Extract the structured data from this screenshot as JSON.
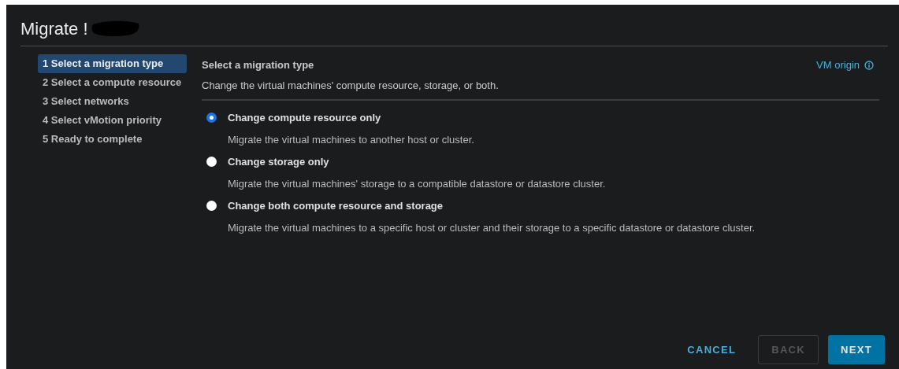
{
  "dialog": {
    "title": "Migrate !"
  },
  "steps": [
    {
      "label": "1 Select a migration type",
      "selected": true
    },
    {
      "label": "2 Select a compute resource",
      "selected": false
    },
    {
      "label": "3 Select networks",
      "selected": false
    },
    {
      "label": "4 Select vMotion priority",
      "selected": false
    },
    {
      "label": "5 Ready to complete",
      "selected": false
    }
  ],
  "content": {
    "heading": "Select a migration type",
    "subtitle": "Change the virtual machines' compute resource, storage, or both.",
    "link": "VM origin"
  },
  "options": [
    {
      "label": "Change compute resource only",
      "description": "Migrate the virtual machines to another host or cluster.",
      "selected": true
    },
    {
      "label": "Change storage only",
      "description": "Migrate the virtual machines' storage to a compatible datastore or datastore cluster.",
      "selected": false
    },
    {
      "label": "Change both compute resource and storage",
      "description": "Migrate the virtual machines to a specific host or cluster and their storage to a specific datastore or datastore cluster.",
      "selected": false
    }
  ],
  "buttons": [
    {
      "label": "CANCEL",
      "kind": "link",
      "disabled": false
    },
    {
      "label": "BACK",
      "kind": "outline",
      "disabled": true
    },
    {
      "label": "NEXT",
      "kind": "primary",
      "disabled": false
    }
  ]
}
